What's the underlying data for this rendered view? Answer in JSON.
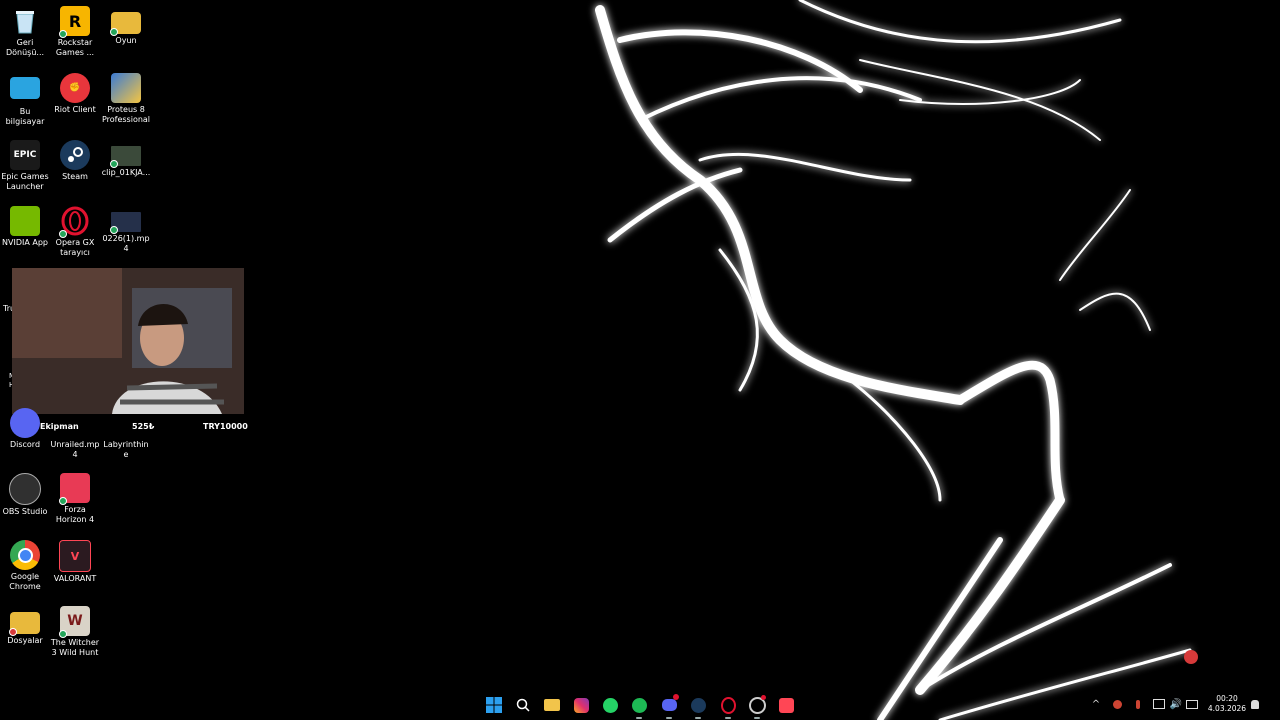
{
  "desktop_icons": [
    {
      "id": "recycle",
      "label": "Geri Dönüşü..."
    },
    {
      "id": "rockstar",
      "label": "Rockstar Games ..."
    },
    {
      "id": "oyun",
      "label": "Oyun"
    },
    {
      "id": "thispc",
      "label": "Bu bilgisayar"
    },
    {
      "id": "riot",
      "label": "Riot Client"
    },
    {
      "id": "proteus",
      "label": "Proteus 8 Professional"
    },
    {
      "id": "epic",
      "label": "Epic Games Launcher"
    },
    {
      "id": "steam",
      "label": "Steam"
    },
    {
      "id": "clip",
      "label": "clip_01KJA..."
    },
    {
      "id": "nvidia",
      "label": "NVIDIA App"
    },
    {
      "id": "operagx",
      "label": "Opera GX tarayıcı"
    },
    {
      "id": "mp4",
      "label": "0226(1).mp4"
    },
    {
      "id": "discord",
      "label": "Discord"
    },
    {
      "id": "unrailed",
      "label": "Unrailed.mp4"
    },
    {
      "id": "labyrinthine",
      "label": "Labyrinthine"
    },
    {
      "id": "obs",
      "label": "OBS Studio"
    },
    {
      "id": "forza",
      "label": "Forza Horizon 4"
    },
    {
      "id": "chrome",
      "label": "Google Chrome"
    },
    {
      "id": "valorant",
      "label": "VALORANT"
    },
    {
      "id": "dosyalar",
      "label": "Dosyalar"
    },
    {
      "id": "witcher",
      "label": "The Witcher 3 Wild Hunt"
    }
  ],
  "partial_icons": {
    "tru": "Tru",
    "m": "M",
    "h": "H"
  },
  "overlay": {
    "left": "Ekipman",
    "middle": "525₺",
    "right": "TRY10000"
  },
  "taskbar": {
    "apps": [
      "start",
      "search",
      "file-explorer",
      "instagram",
      "whatsapp",
      "spotify",
      "discord",
      "steam",
      "opera-gx",
      "chrome-like",
      "valorant"
    ]
  },
  "tray": {
    "time": "00:20",
    "date": "4.03.2026"
  },
  "colors": {
    "accent": "#0078d4",
    "spotify": "#1db954",
    "whatsapp": "#25d366",
    "discord": "#5865f2",
    "opera": "#e0122f",
    "valorant": "#ff4655"
  }
}
